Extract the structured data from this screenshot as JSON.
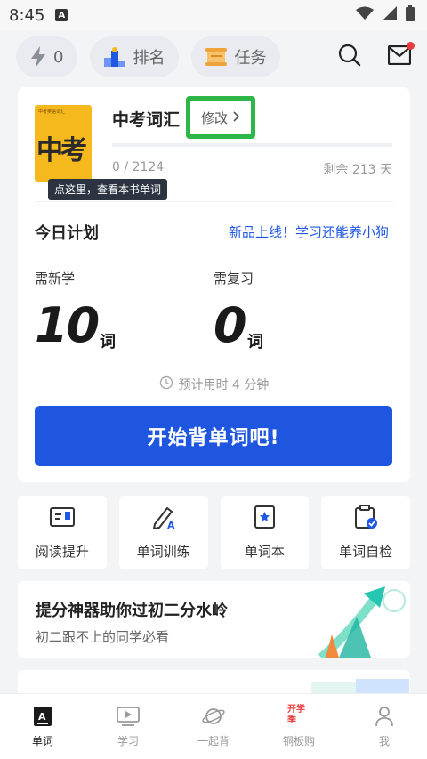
{
  "status_bar": {
    "time": "8:45",
    "sim_label": "A"
  },
  "top_bar": {
    "energy_count": "0",
    "ranking_label": "排名",
    "tasks_label": "任务"
  },
  "book": {
    "cover_header": "中考英语词汇",
    "cover_big_text": "中考",
    "title": "中考词汇",
    "edit_label": "修改",
    "progress_text": "0 / 2124",
    "progress_fraction": 0.0,
    "days_left": "剩余 213 天",
    "tooltip": "点这里，查看本书单词"
  },
  "plan": {
    "title": "今日计划",
    "promo_link": "新品上线！学习还能养小狗",
    "new_label": "需新学",
    "new_count": "10",
    "new_unit": "词",
    "review_label": "需复习",
    "review_count": "0",
    "review_unit": "词",
    "estimate": "预计用时 4 分钟",
    "start_button": "开始背单词吧!"
  },
  "tools": [
    {
      "label": "阅读提升",
      "icon": "reading-icon"
    },
    {
      "label": "单词训练",
      "icon": "pen-icon"
    },
    {
      "label": "单词本",
      "icon": "wordbook-icon"
    },
    {
      "label": "单词自检",
      "icon": "clipboard-check-icon"
    }
  ],
  "promo": {
    "headline": "提分神器助你过初二分水岭",
    "subline": "初二跟不上的同学必看"
  },
  "bottom_nav": [
    {
      "label": "单词",
      "active": true
    },
    {
      "label": "学习",
      "active": false
    },
    {
      "label": "一起背",
      "active": false
    },
    {
      "label": "铜板购",
      "active": false,
      "badge": "开学季"
    },
    {
      "label": "我",
      "active": false
    }
  ],
  "colors": {
    "accent": "#1f56e0",
    "highlight_box": "#2fb649",
    "cover": "#f5b91e",
    "notification_dot": "#e93b3b"
  }
}
